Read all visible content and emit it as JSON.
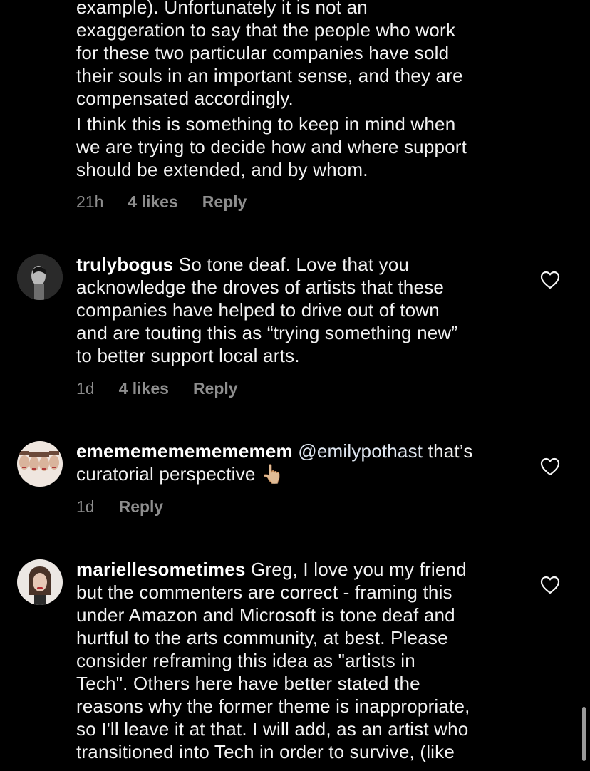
{
  "comments": [
    {
      "lines": [
        "example). Unfortunately it is not an",
        "exaggeration to say that the people who work",
        "for these two particular companies have sold",
        "their souls in an important sense, and they are",
        "compensated accordingly.",
        "I think this is something to keep in mind when",
        "we are trying to decide how and where support",
        "should be extended, and by whom."
      ],
      "time": "21h",
      "likes": "4 likes",
      "reply": "Reply"
    },
    {
      "username": "trulybogus",
      "first_line": "So tone deaf. Love that you",
      "lines": [
        "acknowledge the droves of artists that these",
        "companies have helped to drive out of town",
        "and are touting this as “trying something new”",
        "to better support local arts."
      ],
      "time": "1d",
      "likes": "4 likes",
      "reply": "Reply",
      "avatar_icon": "avatar-icon",
      "like_icon": "heart-icon"
    },
    {
      "username": "emememememememem",
      "mention": "@emilypothast",
      "first_line_rest": " that’s",
      "second_line": "curatorial perspective",
      "emoji": "👆🏼",
      "time": "1d",
      "reply": "Reply",
      "avatar_icon": "avatar-icon",
      "like_icon": "heart-icon"
    },
    {
      "username": "mariellesometimes",
      "first_line": "Greg, I love you my friend",
      "lines": [
        "but the commenters are correct - framing this",
        "under Amazon and Microsoft is tone deaf and",
        "hurtful to the arts community, at best. Please",
        "consider reframing this idea as \"artists in",
        "Tech\". Others here have better stated the",
        "reasons why the former theme is inappropriate,",
        "so I'll leave it at that. I will add, as an artist who",
        "transitioned into Tech in order to survive, (like"
      ],
      "avatar_icon": "avatar-icon",
      "like_icon": "heart-icon"
    }
  ],
  "colors": {
    "background": "#000000",
    "text": "#f2f2f2",
    "meta": "#8e8e8e"
  }
}
